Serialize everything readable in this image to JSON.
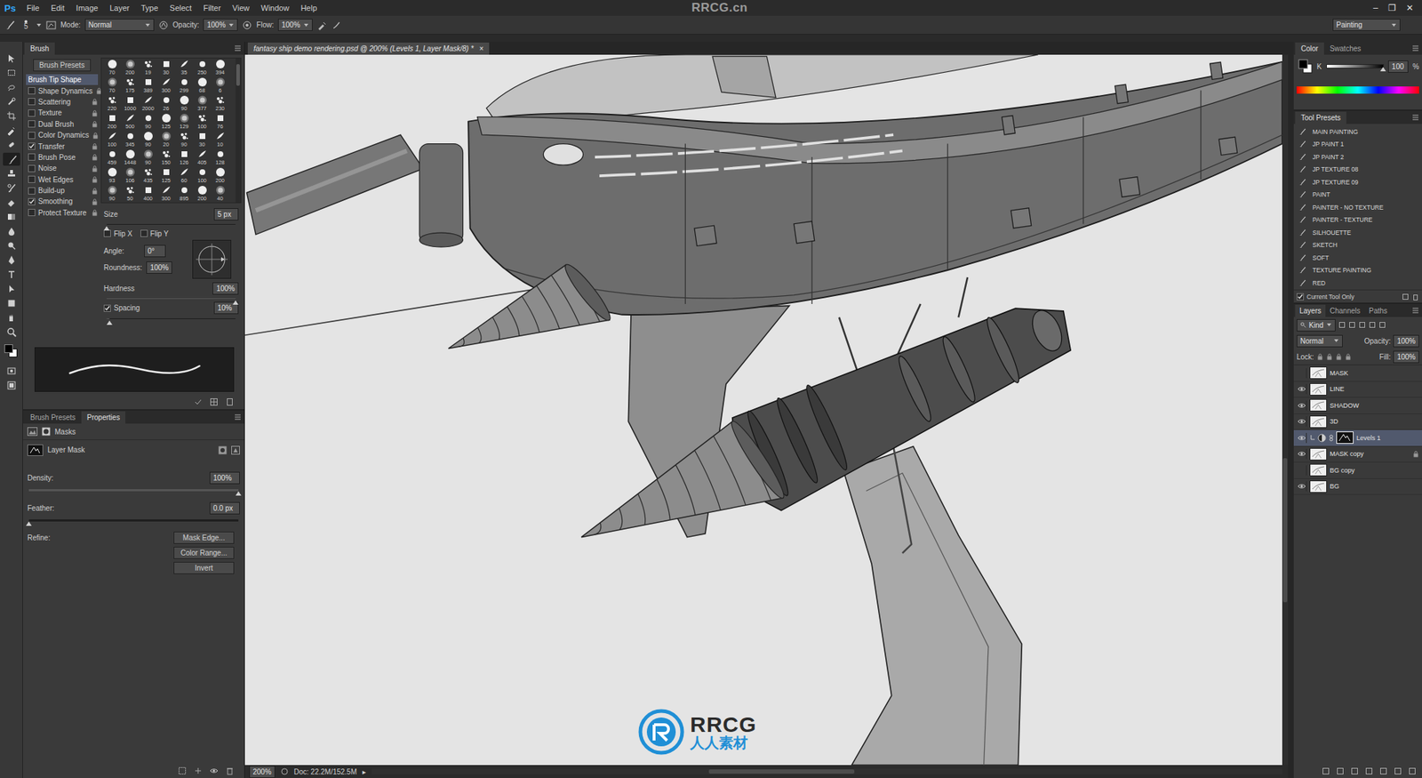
{
  "app": {
    "logo": "Ps",
    "title": "RRCG.cn",
    "window_controls": [
      "–",
      "❐",
      "✕"
    ]
  },
  "menu": [
    "File",
    "Edit",
    "Image",
    "Layer",
    "Type",
    "Select",
    "Filter",
    "View",
    "Window",
    "Help"
  ],
  "options_bar": {
    "brush_size": "5",
    "mode_label": "Mode:",
    "mode": "Normal",
    "opacity_label": "Opacity:",
    "opacity": "100%",
    "flow_label": "Flow:",
    "flow": "100%",
    "workspace": "Painting"
  },
  "tools": [
    {
      "selected": false
    },
    {
      "selected": false
    },
    {
      "selected": false
    },
    {
      "selected": false
    },
    {
      "selected": false
    },
    {
      "selected": false
    },
    {
      "selected": false
    },
    {
      "selected": true
    },
    {
      "selected": false
    },
    {
      "selected": false
    },
    {
      "selected": false
    },
    {
      "selected": false
    },
    {
      "selected": false
    },
    {
      "selected": false
    },
    {
      "selected": false
    },
    {
      "selected": false
    },
    {
      "selected": false
    },
    {
      "selected": false
    },
    {
      "selected": false
    },
    {
      "selected": false
    },
    {
      "selected": false
    },
    {
      "selected": false
    }
  ],
  "brush_panel": {
    "tab": "Brush",
    "presets_button": "Brush Presets",
    "tip_shape": {
      "label": "Brush Tip Shape",
      "selected": true
    },
    "options": [
      {
        "label": "Shape Dynamics",
        "checked": false
      },
      {
        "label": "Scattering",
        "checked": false
      },
      {
        "label": "Texture",
        "checked": false
      },
      {
        "label": "Dual Brush",
        "checked": false
      },
      {
        "label": "Color Dynamics",
        "checked": false
      },
      {
        "label": "Transfer",
        "checked": true
      },
      {
        "label": "Brush Pose",
        "checked": false
      },
      {
        "label": "Noise",
        "checked": false
      },
      {
        "label": "Wet Edges",
        "checked": false
      },
      {
        "label": "Build-up",
        "checked": false
      },
      {
        "label": "Smoothing",
        "checked": true
      },
      {
        "label": "Protect Texture",
        "checked": false
      }
    ],
    "tip_sizes": [
      [
        "70",
        "200",
        "19",
        "30",
        "35",
        "250",
        "394"
      ],
      [
        "70",
        "175",
        "389",
        "300",
        "299",
        "68",
        "6"
      ],
      [
        "220",
        "1000",
        "2000",
        "26",
        "90",
        "377",
        "230"
      ],
      [
        "200",
        "500",
        "90",
        "125",
        "129",
        "100",
        "76"
      ],
      [
        "100",
        "345",
        "90",
        "20",
        "90",
        "30",
        "10"
      ],
      [
        "459",
        "1448",
        "90",
        "150",
        "126",
        "405",
        "128"
      ],
      [
        "93",
        "106",
        "435",
        "125",
        "60",
        "100",
        "200"
      ],
      [
        "90",
        "50",
        "400",
        "300",
        "895",
        "200",
        "40"
      ]
    ],
    "size_label": "Size",
    "size": "5 px",
    "size_level": 0.0,
    "flip_x": {
      "label": "Flip X",
      "checked": false
    },
    "flip_y": {
      "label": "Flip Y",
      "checked": false
    },
    "angle_label": "Angle:",
    "angle": "0°",
    "roundness_label": "Roundness:",
    "roundness": "100%",
    "hardness_label": "Hardness",
    "hardness": "100%",
    "hardness_level": 1,
    "spacing": {
      "label": "Spacing",
      "checked": true,
      "value": "10%",
      "level": 0.02
    }
  },
  "properties_panel": {
    "tabs": [
      {
        "label": "Brush Presets",
        "selected": false
      },
      {
        "label": "Properties",
        "selected": true
      }
    ],
    "title": "Masks",
    "mask_label": "Layer Mask",
    "density_label": "Density:",
    "density": "100%",
    "density_level": 1,
    "feather_label": "Feather:",
    "feather": "0.0 px",
    "feather_level": 0,
    "refine_label": "Refine:",
    "buttons": [
      "Mask Edge...",
      "Color Range...",
      "Invert"
    ]
  },
  "document": {
    "tab": "fantasy ship demo rendering.psd @ 200% (Levels 1, Layer Mask/8) *",
    "close": "×"
  },
  "status_bar": {
    "zoom": "200%",
    "doc": "Doc: 22.2M/152.5M",
    "arrow": "▸"
  },
  "color_panel": {
    "tabs": [
      {
        "label": "Color",
        "selected": true
      },
      {
        "label": "Swatches",
        "selected": false
      }
    ],
    "channel": "K",
    "value": "100",
    "unit": "%",
    "level": 1
  },
  "tool_presets": {
    "title": "Tool Presets",
    "items": [
      "MAIN PAINTING",
      "JP PAINT 1",
      "JP PAINT 2",
      "JP TEXTURE 08",
      "JP TEXTURE 09",
      "PAINT",
      "PAINTER - NO TEXTURE",
      "PAINTER - TEXTURE",
      "SILHOUETTE",
      "SKETCH",
      "SOFT",
      "TEXTURE PAINTING",
      "RED"
    ],
    "current_tool_only": {
      "label": "Current Tool Only",
      "checked": true
    }
  },
  "layers_panel": {
    "tabs": [
      {
        "label": "Layers",
        "selected": true
      },
      {
        "label": "Channels",
        "selected": false
      },
      {
        "label": "Paths",
        "selected": false
      }
    ],
    "filter": "Kind",
    "blend_mode": "Normal",
    "opacity_label": "Opacity:",
    "opacity": "100%",
    "lock_label": "Lock:",
    "fill_label": "Fill:",
    "fill": "100%",
    "layers": [
      {
        "name": "MASK",
        "visible": false,
        "selected": false,
        "locked": false,
        "kind": "pixel"
      },
      {
        "name": "LINE",
        "visible": true,
        "selected": false,
        "locked": false,
        "kind": "pixel"
      },
      {
        "name": "SHADOW",
        "visible": true,
        "selected": false,
        "locked": false,
        "kind": "pixel"
      },
      {
        "name": "3D",
        "visible": true,
        "selected": false,
        "locked": false,
        "kind": "pixel"
      },
      {
        "name": "Levels 1",
        "visible": true,
        "selected": true,
        "locked": false,
        "kind": "adjustment"
      },
      {
        "name": "MASK copy",
        "visible": true,
        "selected": false,
        "locked": true,
        "kind": "pixel"
      },
      {
        "name": "BG copy",
        "visible": false,
        "selected": false,
        "locked": false,
        "kind": "pixel"
      },
      {
        "name": "BG",
        "visible": true,
        "selected": false,
        "locked": false,
        "kind": "pixel"
      }
    ]
  },
  "watermark": {
    "mark": "RRCG",
    "sub": "人人素材"
  }
}
